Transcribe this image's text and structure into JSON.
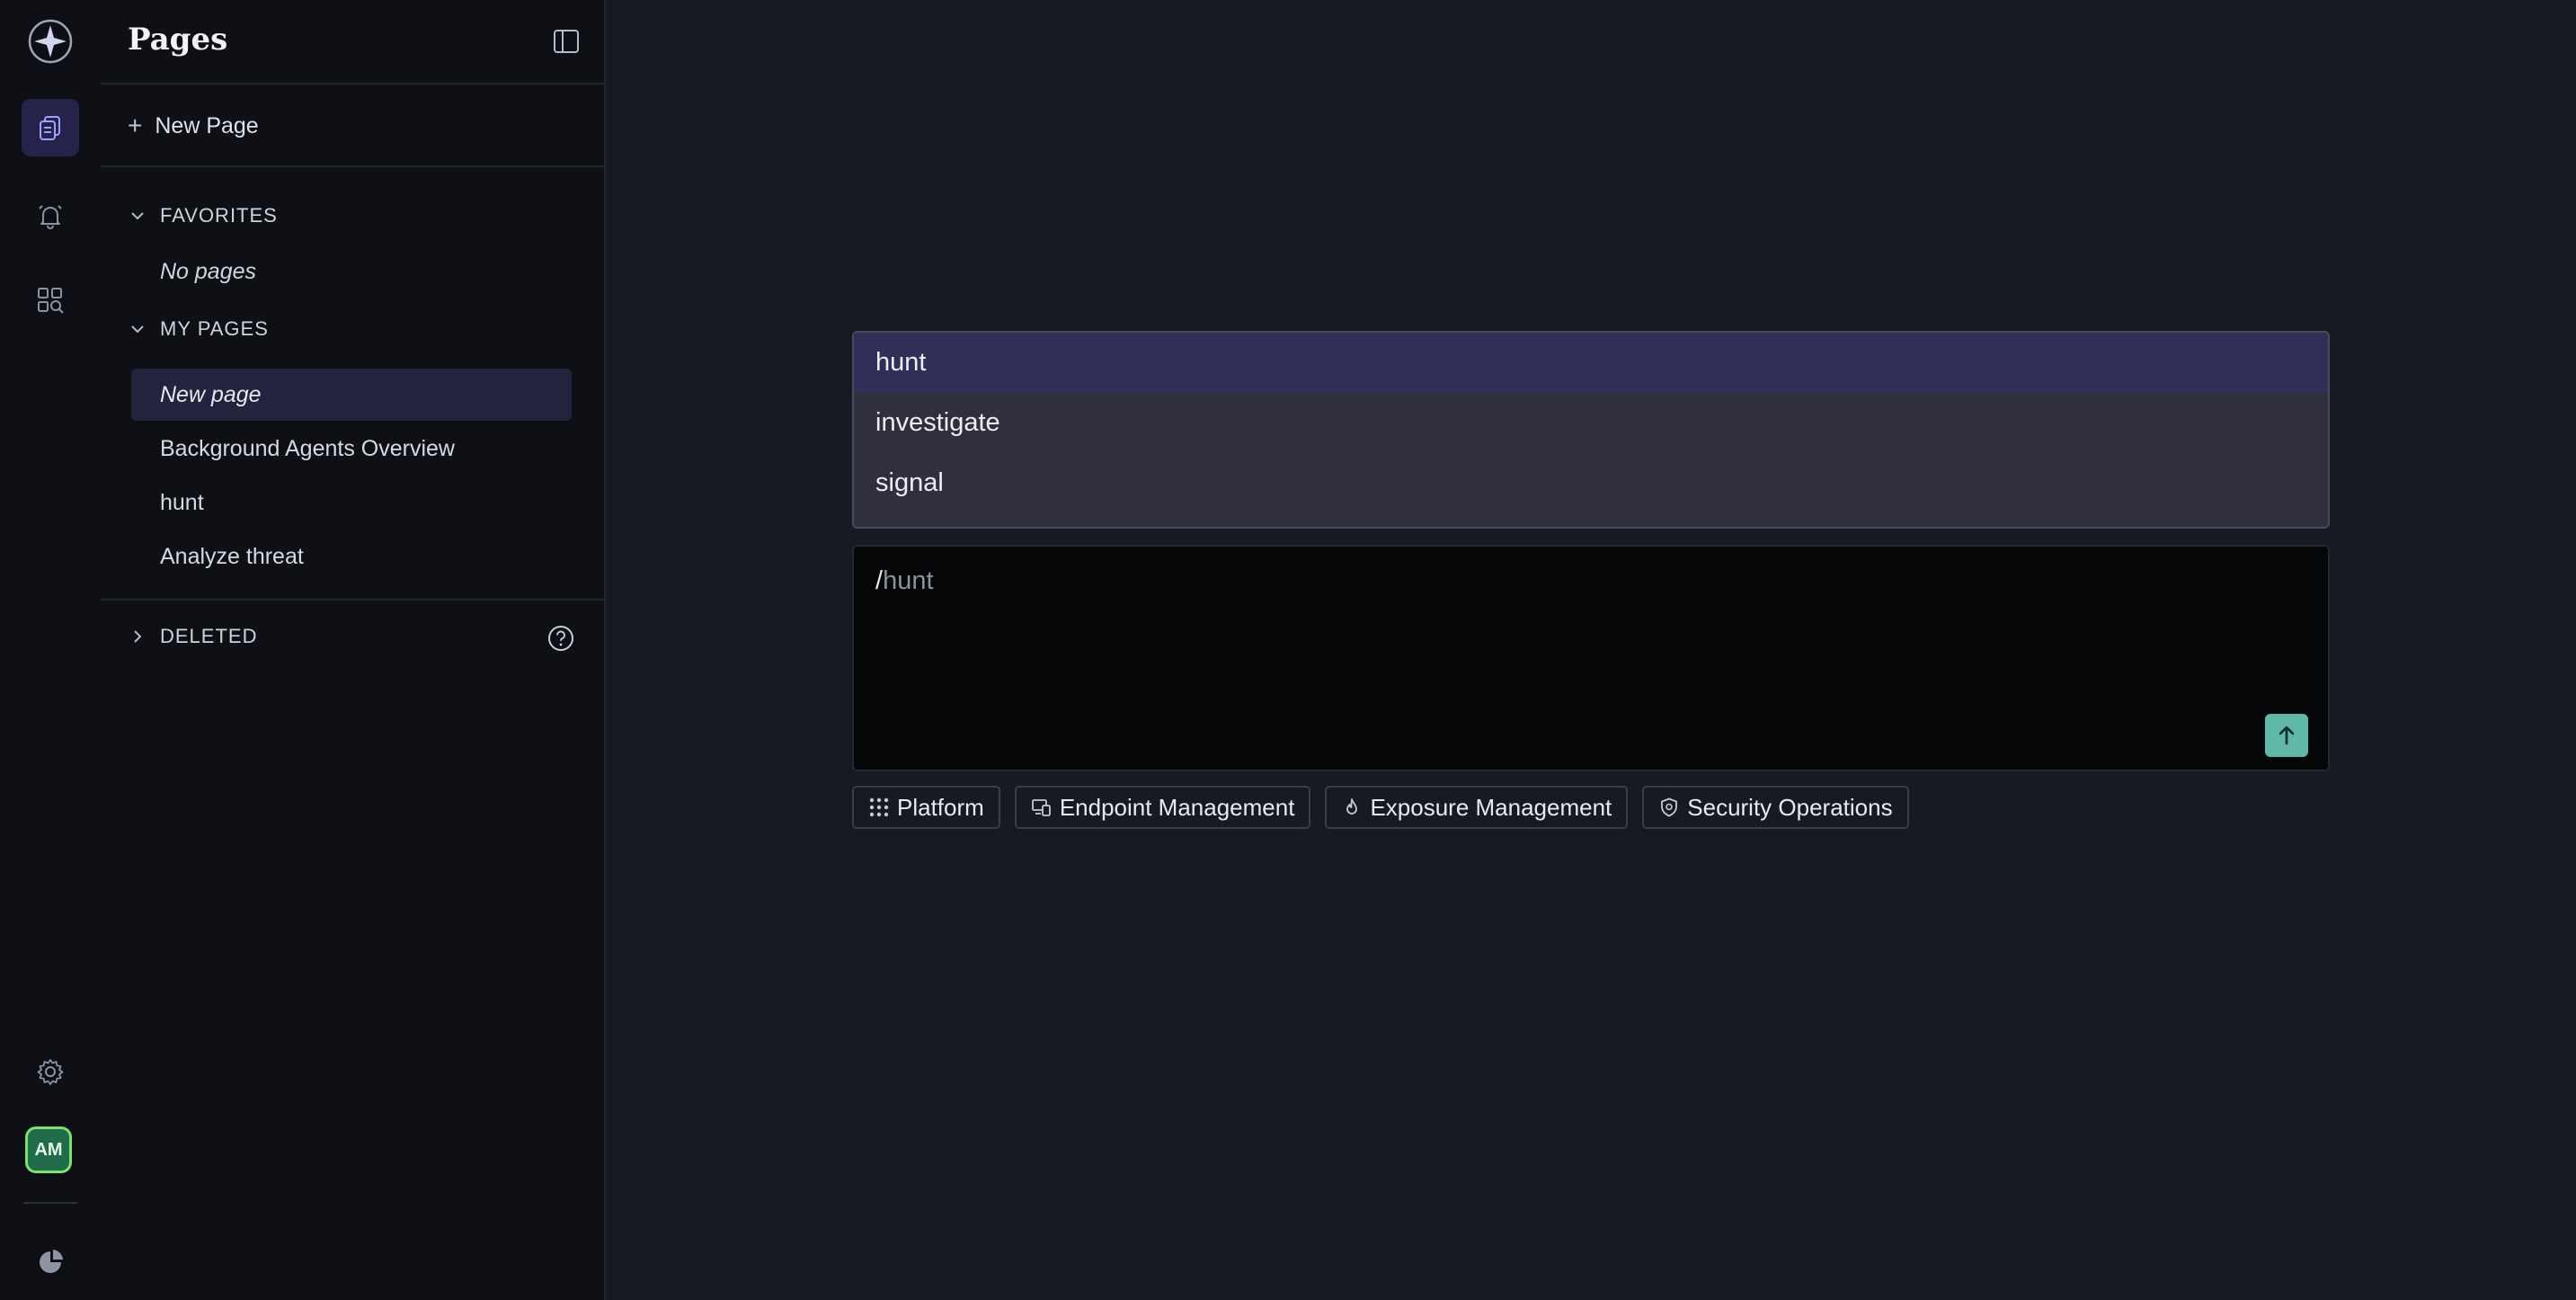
{
  "rail": {
    "icons": [
      "app-logo-icon",
      "pages-icon",
      "bell-icon",
      "apps-search-icon",
      "gear-icon",
      "chart-pie-icon"
    ],
    "avatar_initials": "AM",
    "accent": "#26234a"
  },
  "sidebar": {
    "title": "Pages",
    "new_page_label": "New Page",
    "favorites": {
      "label": "FAVORITES",
      "empty_text": "No pages"
    },
    "my_pages": {
      "label": "MY PAGES",
      "items": [
        {
          "label": "New page",
          "selected": true
        },
        {
          "label": "Background Agents Overview"
        },
        {
          "label": "hunt"
        },
        {
          "label": "Analyze threat"
        }
      ]
    },
    "deleted": {
      "label": "DELETED"
    }
  },
  "suggestions": {
    "items": [
      "hunt",
      "investigate",
      "signal"
    ],
    "active_index": 0
  },
  "prompt": {
    "typed": "/",
    "ghost": "hunt",
    "send_color": "#5fb7a8"
  },
  "chips": [
    {
      "label": "Platform",
      "icon": "grid-dots-icon"
    },
    {
      "label": "Endpoint Management",
      "icon": "devices-icon"
    },
    {
      "label": "Exposure Management",
      "icon": "flame-icon"
    },
    {
      "label": "Security Operations",
      "icon": "shield-icon"
    }
  ]
}
